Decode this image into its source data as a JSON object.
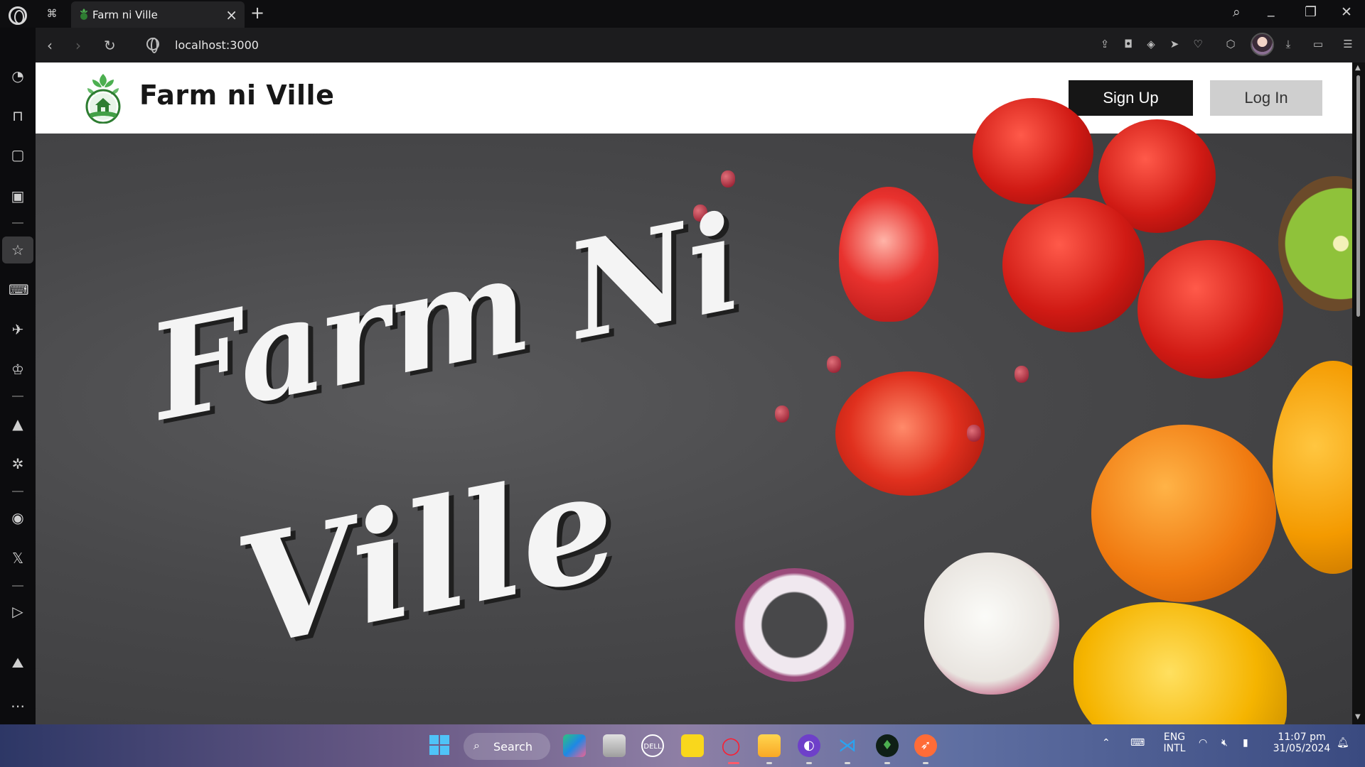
{
  "browser": {
    "tab_title": "Farm ni Ville",
    "url": "localhost:3000"
  },
  "site": {
    "brand": "Farm ni Ville",
    "signup_label": "Sign Up",
    "login_label": "Log In",
    "hero_line1": "Farm Ni",
    "hero_line2": "Ville"
  },
  "taskbar": {
    "search_label": "Search",
    "lang_top": "ENG",
    "lang_bottom": "INTL",
    "time": "11:07 pm",
    "date": "31/05/2024"
  },
  "colors": {
    "signup_bg": "#161616",
    "login_bg": "#cfcfcf",
    "hero_bg": "#48484a",
    "logo_green": "#3a8a3e"
  },
  "icons": {
    "sidebar": [
      "speed-dial-icon",
      "extensions-icon",
      "twitch-icon",
      "ai-chip-icon",
      "bookmarks-icon",
      "gaming-icon",
      "flights-icon",
      "crown-icon",
      "aria-icon",
      "chatgpt-icon",
      "messenger-icon",
      "x-icon",
      "player-icon",
      "gallery-icon",
      "more-icon"
    ],
    "toolbar": [
      "share-icon",
      "snapshot-icon",
      "vpn-shield-icon",
      "send-icon",
      "heart-icon",
      "cube-icon",
      "download-icon",
      "battery-icon",
      "easy-setup-icon"
    ]
  }
}
